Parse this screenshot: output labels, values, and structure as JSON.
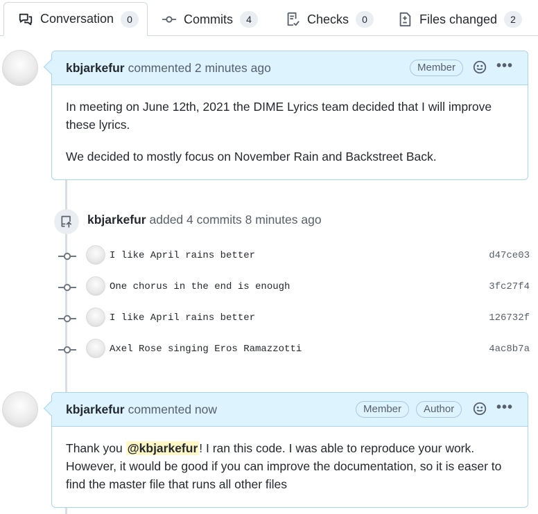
{
  "tabs": [
    {
      "label": "Conversation",
      "count": "0",
      "icon": "comment-discussion-icon",
      "active": true
    },
    {
      "label": "Commits",
      "count": "4",
      "icon": "git-commit-icon"
    },
    {
      "label": "Checks",
      "count": "0",
      "icon": "checklist-icon"
    },
    {
      "label": "Files changed",
      "count": "2",
      "icon": "file-diff-icon"
    }
  ],
  "comment1": {
    "author": "kbjarkefur",
    "action": "commented 2 minutes ago",
    "badge": "Member",
    "body": [
      "In meeting on June 12th, 2021 the DIME Lyrics team decided that I will improve these lyrics.",
      "We decided to mostly focus on November Rain and Backstreet Back."
    ]
  },
  "commits_event": {
    "author": "kbjarkefur",
    "action": "added 4 commits 8 minutes ago",
    "icon": "repo-push-icon"
  },
  "commits": [
    {
      "message": "I like April rains better",
      "sha": "d47ce03"
    },
    {
      "message": "One chorus in the end is enough",
      "sha": "3fc27f4"
    },
    {
      "message": "I like April rains better",
      "sha": "126732f"
    },
    {
      "message": "Axel Rose singing Eros Ramazzotti",
      "sha": "4ac8b7a"
    }
  ],
  "comment2": {
    "author": "kbjarkefur",
    "action": "commented now",
    "badges": [
      "Member",
      "Author"
    ],
    "body_before": "Thank you ",
    "mention": "@kbjarkefur",
    "body_after": "! I ran this code. I was able to reproduce your work. However, it would be good if you can improve the documentation, so it is easer to find the master file that runs all other files"
  },
  "colors": {
    "accent_bg": "#ddf4ff",
    "accent_border": "#a8d4f5",
    "mention_bg": "#fff8c5"
  }
}
